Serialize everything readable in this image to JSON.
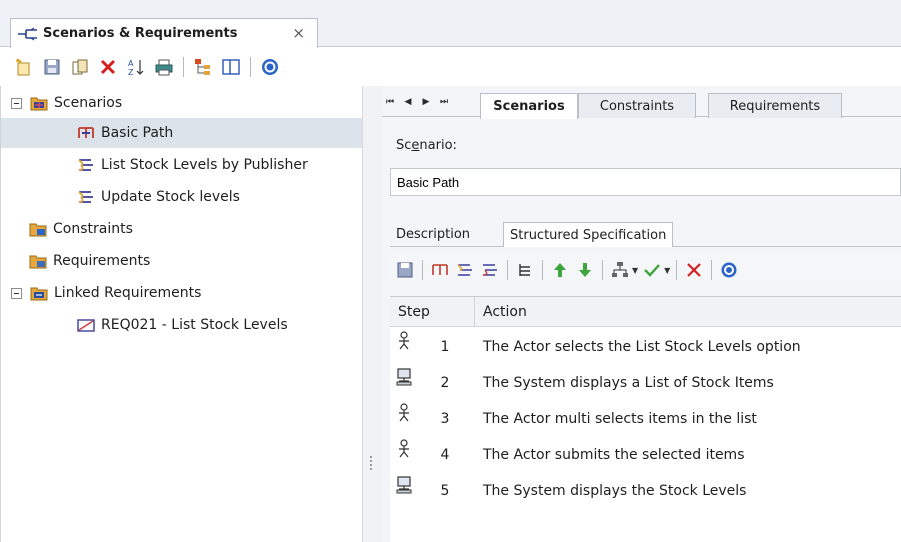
{
  "window_tab": {
    "label": "Scenarios & Requirements",
    "close": "×",
    "icon": "scenario-window-icon"
  },
  "toolbar": {
    "buttons": [
      "new-item-icon",
      "save-icon",
      "copy-icon",
      "delete-icon",
      "sort-icon",
      "print-icon",
      "hierarchy-icon",
      "layout-icon",
      "help-icon"
    ]
  },
  "tree": {
    "scenarios": {
      "label": "Scenarios",
      "icon": "scenarios-folder-icon"
    },
    "items": [
      {
        "label": "Basic Path",
        "icon": "basic-path-icon"
      },
      {
        "label": "List Stock Levels by Publisher",
        "icon": "alternate-path-icon"
      },
      {
        "label": "Update Stock levels",
        "icon": "alternate-path-icon"
      }
    ],
    "constraints": {
      "label": "Constraints",
      "icon": "constraints-folder-icon"
    },
    "requirements": {
      "label": "Requirements",
      "icon": "requirements-folder-icon"
    },
    "linked": {
      "label": "Linked Requirements",
      "icon": "linked-requirements-icon"
    },
    "linked_items": [
      {
        "label": "REQ021 - List Stock Levels",
        "icon": "requirement-icon"
      }
    ]
  },
  "nav": {
    "first": "⏮",
    "prev": "◀",
    "next": "▶",
    "last": "⏭"
  },
  "page_tabs": [
    "Scenarios",
    "Constraints",
    "Requirements"
  ],
  "scenario": {
    "label_pre": "Sc",
    "label_accel": "e",
    "label_post": "nario:",
    "value": "Basic Path"
  },
  "sub_tabs": [
    "Description",
    "Structured Specification"
  ],
  "spec_toolbar": {
    "buttons": [
      "save-icon",
      "basic-path-icon",
      "alternate-path-icon",
      "exception-path-icon",
      "indent-icon",
      "move-up-icon",
      "move-down-icon",
      "generate-diagram-icon",
      "validate-icon",
      "delete-icon",
      "help-icon"
    ]
  },
  "grid": {
    "columns": [
      "Step",
      "Action"
    ],
    "rows": [
      {
        "step": "1",
        "actor": "actor",
        "action": "The Actor selects the List Stock Levels option"
      },
      {
        "step": "2",
        "actor": "system",
        "action": "The System displays a List of Stock Items"
      },
      {
        "step": "3",
        "actor": "actor",
        "action": "The Actor multi selects items in the list"
      },
      {
        "step": "4",
        "actor": "actor",
        "action": "The Actor submits the selected items"
      },
      {
        "step": "5",
        "actor": "system",
        "action": "The System displays the Stock Levels"
      }
    ]
  },
  "colors": {
    "accent_red": "#d42020",
    "arrow_green": "#3ca53c",
    "folder_orange": "#e6a640",
    "help_blue": "#2a64c8"
  }
}
